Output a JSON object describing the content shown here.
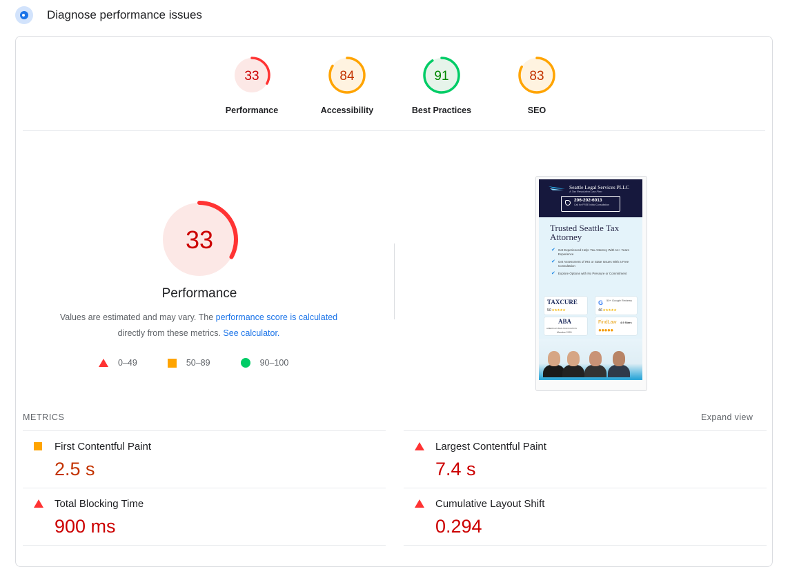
{
  "header": {
    "title": "Diagnose performance issues",
    "icon": "pagespeed-icon"
  },
  "categories": [
    {
      "label": "Performance",
      "score": "33",
      "value": 33,
      "status": "fail"
    },
    {
      "label": "Accessibility",
      "score": "84",
      "value": 84,
      "status": "average"
    },
    {
      "label": "Best Practices",
      "score": "91",
      "value": 91,
      "status": "pass"
    },
    {
      "label": "SEO",
      "score": "83",
      "value": 83,
      "status": "average"
    }
  ],
  "main_gauge": {
    "label": "Performance",
    "score": "33",
    "value": 33
  },
  "description": {
    "text1": "Values are estimated and may vary. The ",
    "link1": "performance score is calculated",
    "text2": "directly from these metrics. ",
    "link2": "See calculator."
  },
  "legend": [
    {
      "label": "0–49",
      "shape": "triangle",
      "color": "#f33"
    },
    {
      "label": "50–89",
      "shape": "square",
      "color": "#ffa400"
    },
    {
      "label": "90–100",
      "shape": "circle",
      "color": "#0c6"
    }
  ],
  "screenshot": {
    "firm": "Seattle Legal Services PLLC",
    "tagline": "A Tax Resolution Law Firm",
    "phone": "206-202-6013",
    "call_text": "Call for FREE Initial Consultation",
    "hero": "Trusted Seattle Tax Attorney",
    "bullets": [
      "Get Experienced Help: Tax Attorney With 14+ Years Experience",
      "Get Assessment of IRS or State Issues With a Free Consultation",
      "Explore Options with No Pressure or Commitment"
    ],
    "badges": {
      "taxcure": "TAXCURE",
      "taxcure_rating": "5.0",
      "google": "50+ Google Reviews",
      "google_rating": "4.6",
      "aba": "ABA",
      "aba_sub": "AMERICAN BAR ASSOCIATION",
      "aba_member": "Member 2020",
      "findlaw": "FindLaw",
      "findlaw_rating": "4.9 Stars"
    }
  },
  "metrics": {
    "section_label": "METRICS",
    "expand_label": "Expand view",
    "items": [
      {
        "name": "First Contentful Paint",
        "value": "2.5 s",
        "status": "average"
      },
      {
        "name": "Largest Contentful Paint",
        "value": "7.4 s",
        "status": "fail"
      },
      {
        "name": "Total Blocking Time",
        "value": "900 ms",
        "status": "fail"
      },
      {
        "name": "Cumulative Layout Shift",
        "value": "0.294",
        "status": "fail"
      }
    ]
  },
  "colors": {
    "fail": "#f33",
    "fail_text": "#c00",
    "fail_bg": "#fce8e6",
    "average": "#ffa400",
    "average_text": "#c33300",
    "average_bg": "#fff3e0",
    "pass": "#0c6",
    "pass_text": "#008800",
    "pass_bg": "#e6f4ea",
    "link": "#1a73e8"
  }
}
